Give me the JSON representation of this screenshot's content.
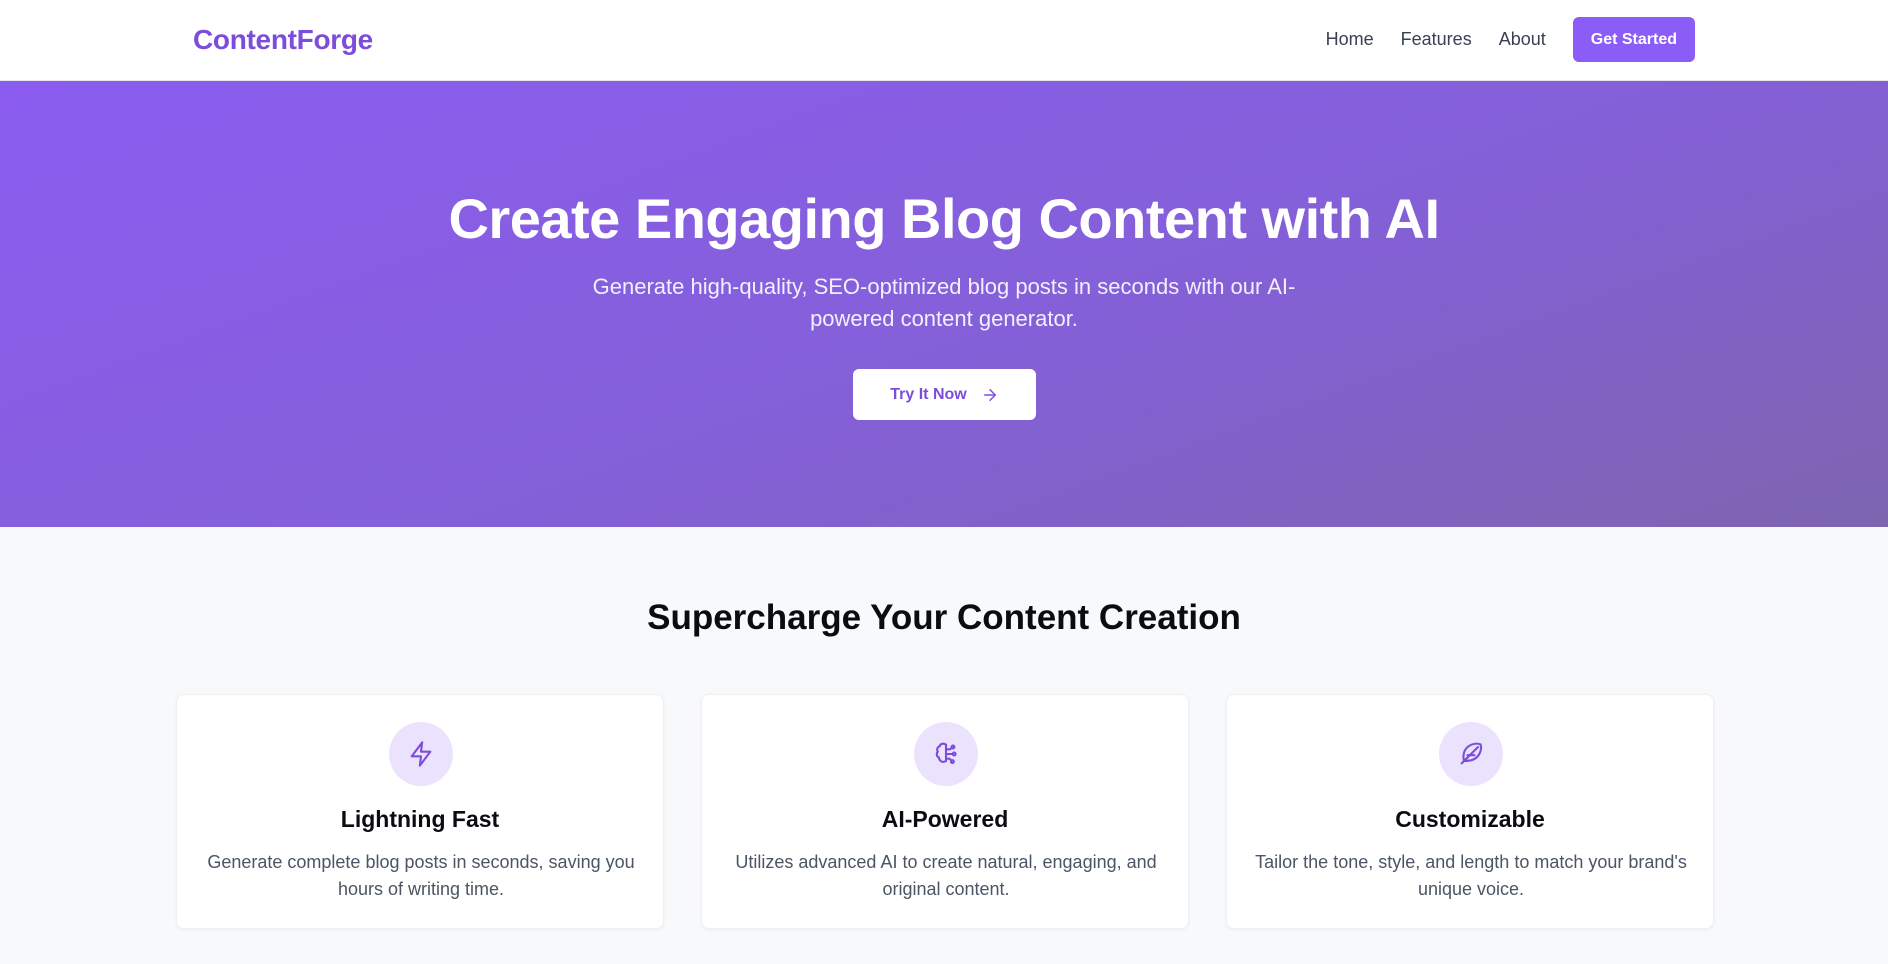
{
  "nav": {
    "logo": "ContentForge",
    "links": [
      "Home",
      "Features",
      "About"
    ],
    "cta": "Get Started"
  },
  "hero": {
    "title": "Create Engaging Blog Content with AI",
    "subtitle": "Generate high-quality, SEO-optimized blog posts in seconds with our AI-powered content generator.",
    "button_label": "Try It Now",
    "button_icon": "arrow-right-icon"
  },
  "features": {
    "title": "Supercharge Your Content Creation",
    "cards": [
      {
        "icon": "lightning-icon",
        "title": "Lightning Fast",
        "description": "Generate complete blog posts in seconds, saving you hours of writing time."
      },
      {
        "icon": "brain-icon",
        "title": "AI-Powered",
        "description": "Utilizes advanced AI to create natural, engaging, and original content."
      },
      {
        "icon": "feather-icon",
        "title": "Customizable",
        "description": "Tailor the tone, style, and length to match your brand's unique voice."
      }
    ]
  },
  "colors": {
    "accent": "#8b5cf6",
    "logo": "#7c4ddc",
    "hero_gradient_start": "#8b5cf0",
    "hero_gradient_end": "#7e65b0",
    "icon_circle": "#ebe3fd"
  }
}
